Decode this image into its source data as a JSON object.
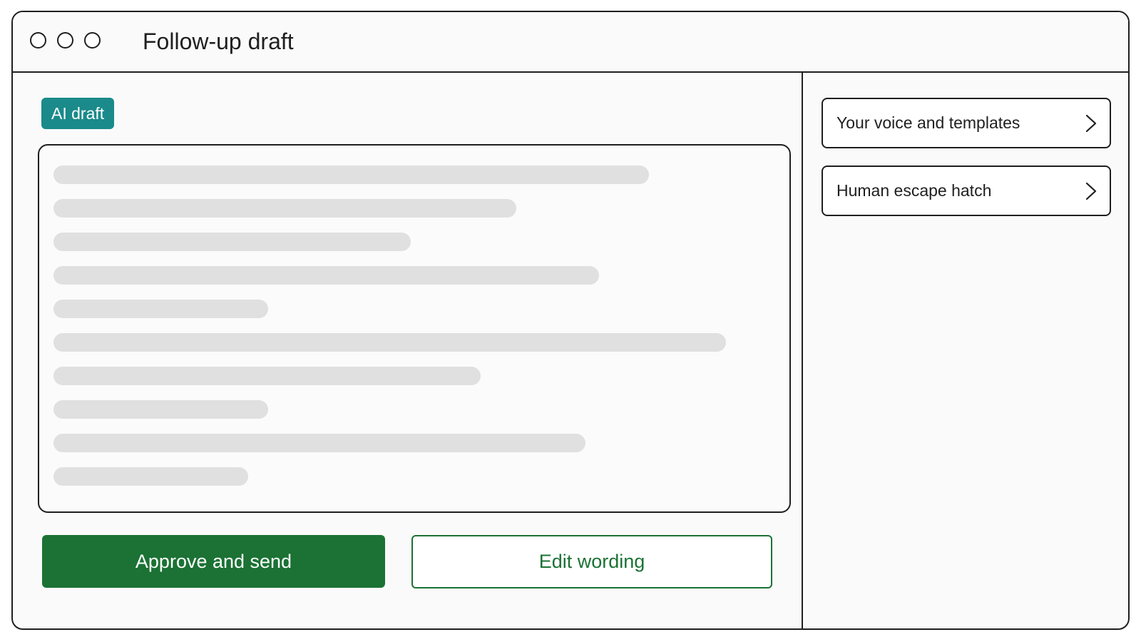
{
  "window": {
    "title": "Follow-up draft"
  },
  "draft": {
    "badge": "AI draft",
    "placeholder_lines": 10
  },
  "actions": {
    "approve_label": "Approve and send",
    "edit_label": "Edit wording"
  },
  "sidebar": {
    "items": [
      {
        "label": "Your voice and templates",
        "icon": "chevron-right-icon"
      },
      {
        "label": "Human escape hatch",
        "icon": "chevron-right-icon"
      }
    ]
  },
  "colors": {
    "badge": "#1a8a8a",
    "primary": "#1b7234",
    "skeleton": "#e0e0e0"
  }
}
